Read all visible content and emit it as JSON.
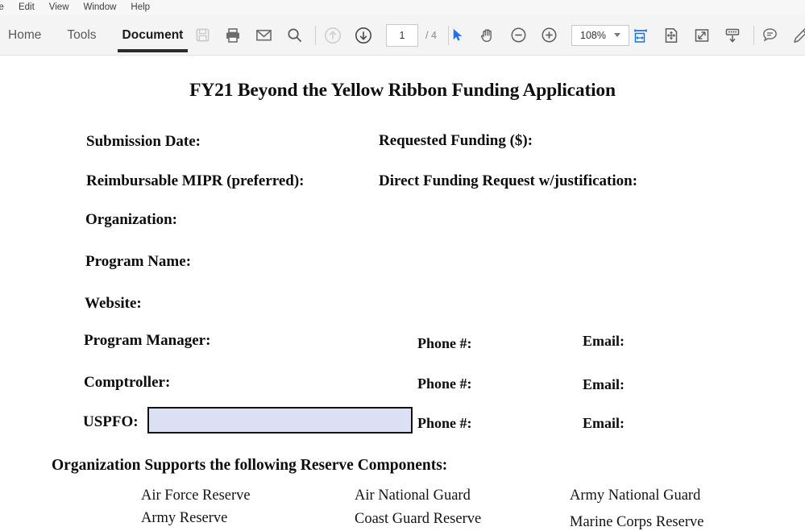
{
  "window": {
    "menubar": [
      {
        "label": "le",
        "name": "menu-file"
      },
      {
        "label": "Edit",
        "name": "menu-edit"
      },
      {
        "label": "View",
        "name": "menu-view"
      },
      {
        "label": "Window",
        "name": "menu-window"
      },
      {
        "label": "Help",
        "name": "menu-help"
      }
    ]
  },
  "toolbar": {
    "tabs": [
      {
        "label": "Home",
        "active": false
      },
      {
        "label": "Tools",
        "active": false
      },
      {
        "label": "Document",
        "active": true
      }
    ],
    "icons": {
      "save": "save-icon",
      "print": "print-icon",
      "email": "email-icon",
      "search": "search-icon",
      "prev_page": "previous-page-icon",
      "next_page": "next-page-icon",
      "select": "select-cursor-icon",
      "hand": "hand-tool-icon",
      "zoom_out": "zoom-out-icon",
      "zoom_in": "zoom-in-icon",
      "fit_width": "fit-width-icon",
      "fit_page": "fit-page-icon",
      "fullscreen": "fullscreen-icon",
      "scroll_mode": "scroll-down-icon",
      "comment": "comment-icon",
      "highlight": "highlighter-icon"
    },
    "page_number": "1",
    "page_count": "/ 4",
    "zoom_level": "108%",
    "accent_color": "#1a73e8"
  },
  "document": {
    "title": "FY21 Beyond the Yellow Ribbon Funding Application",
    "fields": {
      "submission_date": "Submission Date:",
      "requested_funding": "Requested Funding ($):",
      "reimbursable_mipr": "Reimbursable MIPR (preferred):",
      "direct_funding": "Direct Funding Request w/justification:",
      "organization": "Organization:",
      "program_name": "Program Name:",
      "website": "Website:",
      "program_manager": "Program Manager:",
      "program_manager_phone": "Phone #:",
      "program_manager_email": "Email:",
      "comptroller": "Comptroller:",
      "comptroller_phone": "Phone #:",
      "comptroller_email": "Email:",
      "uspfo": "USPFO:",
      "uspfo_phone": "Phone #:",
      "uspfo_email": "Email:"
    },
    "uspfo_input": {
      "value": "",
      "fill_color": "#dce0f5",
      "border_color": "#131313"
    },
    "components_heading": "Organization Supports the following Reserve Components:",
    "components": [
      [
        "Air Force Reserve",
        "Air National Guard",
        "Army National Guard"
      ],
      [
        "Army Reserve",
        "Coast Guard Reserve",
        "Marine Corps Reserve"
      ]
    ]
  }
}
